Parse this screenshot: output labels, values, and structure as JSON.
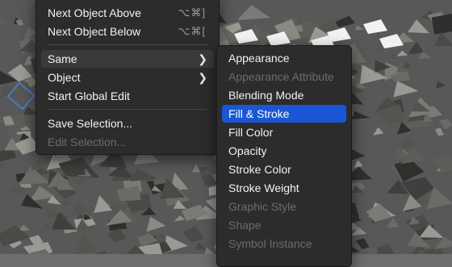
{
  "main_menu": {
    "items": [
      {
        "label": "Next Object Above",
        "shortcut": "⌥⌘]",
        "state": "normal"
      },
      {
        "label": "Next Object Below",
        "shortcut": "⌥⌘[",
        "state": "normal"
      },
      {
        "label": "Same",
        "state": "highlight",
        "submenu": true
      },
      {
        "label": "Object",
        "state": "normal",
        "submenu": true
      },
      {
        "label": "Start Global Edit",
        "state": "normal"
      },
      {
        "label": "Save Selection...",
        "state": "normal"
      },
      {
        "label": "Edit Selection...",
        "state": "disabled"
      }
    ]
  },
  "submenu": {
    "items": [
      {
        "label": "Appearance",
        "state": "normal"
      },
      {
        "label": "Appearance Attribute",
        "state": "disabled"
      },
      {
        "label": "Blending Mode",
        "state": "normal"
      },
      {
        "label": "Fill & Stroke",
        "state": "selected"
      },
      {
        "label": "Fill Color",
        "state": "normal"
      },
      {
        "label": "Opacity",
        "state": "normal"
      },
      {
        "label": "Stroke Color",
        "state": "normal"
      },
      {
        "label": "Stroke Weight",
        "state": "normal"
      },
      {
        "label": "Graphic Style",
        "state": "disabled"
      },
      {
        "label": "Shape",
        "state": "disabled"
      },
      {
        "label": "Symbol Instance",
        "state": "disabled"
      }
    ]
  },
  "colors": {
    "menu_bg": "#2c2c2c",
    "selected": "#1a56d6",
    "disabled_text": "#6c6c6c",
    "canvas": "#6e6e6e"
  }
}
